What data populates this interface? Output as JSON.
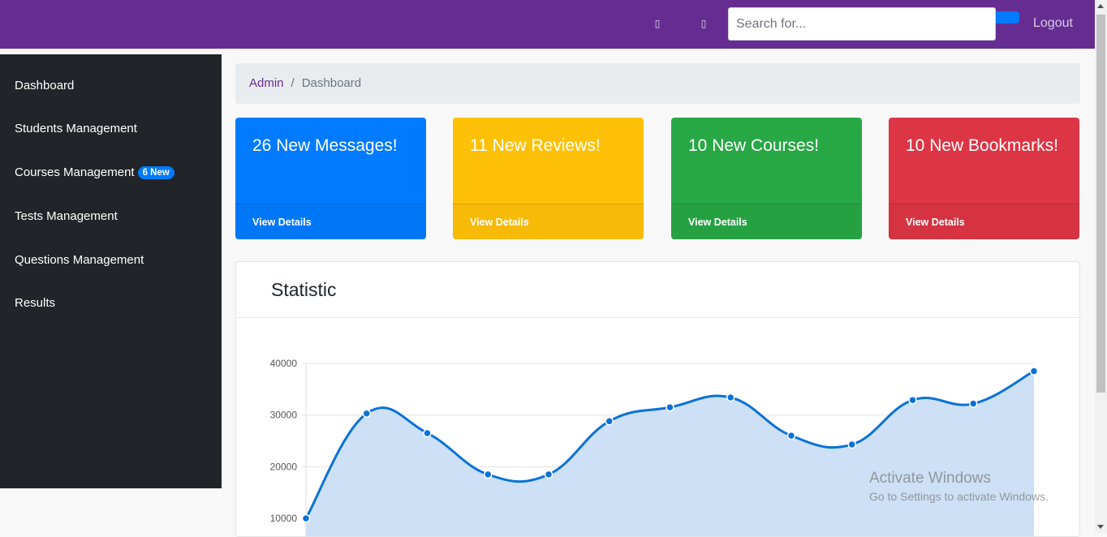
{
  "topbar": {
    "icons": [
      "bell-icon",
      "envelope-icon"
    ],
    "search": {
      "placeholder": "Search for...",
      "value": ""
    },
    "logout_label": "Logout"
  },
  "sidebar": {
    "items": [
      {
        "label": "Dashboard"
      },
      {
        "label": "Students Management"
      },
      {
        "label": "Courses Management",
        "badge": "6 New"
      },
      {
        "label": "Tests Management"
      },
      {
        "label": "Questions Management"
      },
      {
        "label": "Results"
      }
    ]
  },
  "breadcrumb": {
    "link": "Admin",
    "separator": "/",
    "active": "Dashboard"
  },
  "cards": [
    {
      "title": "26 New Messages!",
      "footer": "View Details",
      "color": "#007bff"
    },
    {
      "title": "11 New Reviews!",
      "footer": "View Details",
      "color": "#ffc107"
    },
    {
      "title": "10 New Courses!",
      "footer": "View Details",
      "color": "#28a745"
    },
    {
      "title": "10 New Bookmarks!",
      "footer": "View Details",
      "color": "#dc3545"
    }
  ],
  "statistic": {
    "title": "Statistic"
  },
  "chart_data": {
    "type": "area",
    "title": "",
    "y_ticks": [
      10000,
      20000,
      30000,
      40000
    ],
    "ylim": [
      0,
      40000
    ],
    "grid": true,
    "line_color": "#0b72d6",
    "fill_color": "#cde0f5",
    "series": [
      {
        "values": [
          10000,
          30300,
          26500,
          18500,
          18500,
          28800,
          31500,
          33400,
          26000,
          24300,
          32900,
          32200,
          38500
        ]
      }
    ]
  },
  "watermark": {
    "title": "Activate Windows",
    "subtitle": "Go to Settings to activate Windows."
  }
}
